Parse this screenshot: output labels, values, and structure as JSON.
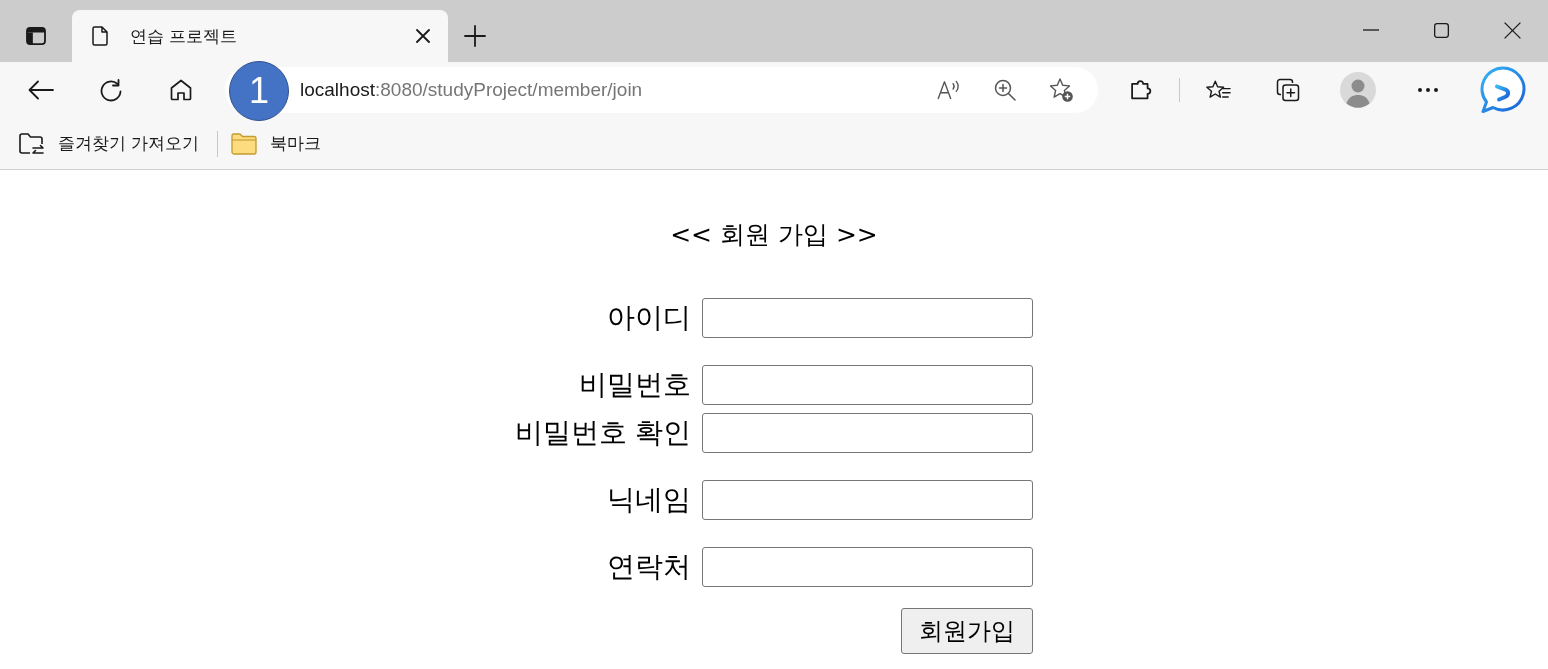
{
  "tabs": [
    {
      "title": "연습 프로젝트",
      "selected": true
    }
  ],
  "address_bar": {
    "host": "localhost",
    "path": ":8080/studyProject/member/join"
  },
  "annotation_badge": {
    "label": "1"
  },
  "bookmarks_bar": {
    "items": [
      {
        "kind": "import",
        "label": "즐겨찾기 가져오기"
      },
      {
        "kind": "folder",
        "label": "북마크"
      }
    ]
  },
  "page": {
    "title": "<< 회원 가입 >>",
    "field_groups": [
      {
        "fields": [
          {
            "label": "아이디"
          }
        ]
      },
      {
        "fields": [
          {
            "label": "비밀번호"
          },
          {
            "label": "비밀번호 확인"
          }
        ]
      },
      {
        "fields": [
          {
            "label": "닉네임"
          }
        ]
      },
      {
        "fields": [
          {
            "label": "연락처"
          }
        ]
      }
    ],
    "submit_button": "회원가입"
  }
}
